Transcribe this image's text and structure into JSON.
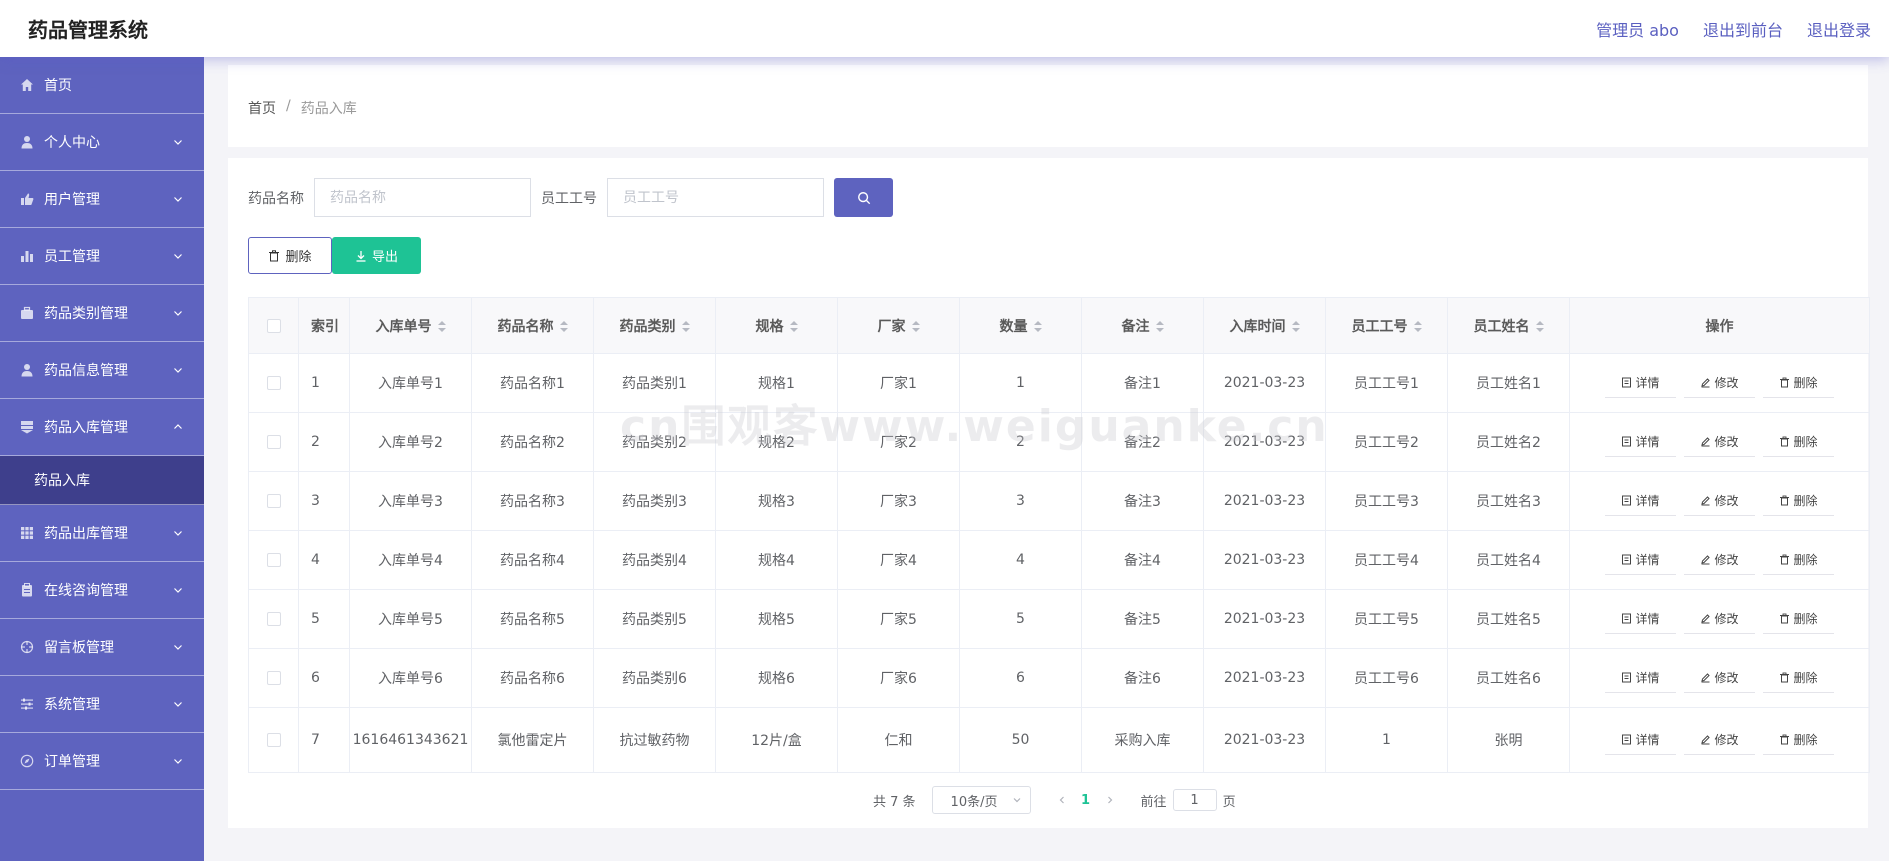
{
  "app": {
    "title": "药品管理系统"
  },
  "header": {
    "user": "管理员 abo",
    "front": "退出到前台",
    "logout": "退出登录"
  },
  "sidebar": {
    "items": [
      {
        "label": "首页",
        "icon": "home-icon",
        "expandable": false
      },
      {
        "label": "个人中心",
        "icon": "user-icon",
        "expandable": true
      },
      {
        "label": "用户管理",
        "icon": "thumb-icon",
        "expandable": true
      },
      {
        "label": "员工管理",
        "icon": "bar-chart-icon",
        "expandable": true
      },
      {
        "label": "药品类别管理",
        "icon": "briefcase-icon",
        "expandable": true
      },
      {
        "label": "药品信息管理",
        "icon": "user-icon",
        "expandable": true
      },
      {
        "label": "药品入库管理",
        "icon": "flag-icon",
        "expandable": true,
        "open": true
      },
      {
        "label": "药品出库管理",
        "icon": "grid-icon",
        "expandable": true
      },
      {
        "label": "在线咨询管理",
        "icon": "clipboard-icon",
        "expandable": true
      },
      {
        "label": "留言板管理",
        "icon": "aperture-icon",
        "expandable": true
      },
      {
        "label": "系统管理",
        "icon": "sliders-icon",
        "expandable": true
      },
      {
        "label": "订单管理",
        "icon": "compass-icon",
        "expandable": true
      }
    ],
    "subitem": "药品入库"
  },
  "breadcrumb": {
    "home": "首页",
    "separator": "/",
    "current": "药品入库"
  },
  "search": {
    "name_label": "药品名称",
    "name_placeholder": "药品名称",
    "staff_label": "员工工号",
    "staff_placeholder": "员工工号"
  },
  "actions": {
    "delete": "删除",
    "export": "导出"
  },
  "table": {
    "headers": [
      "索引",
      "入库单号",
      "药品名称",
      "药品类别",
      "规格",
      "厂家",
      "数量",
      "备注",
      "入库时间",
      "员工工号",
      "员工姓名",
      "操作"
    ],
    "rows": [
      [
        "1",
        "入库单号1",
        "药品名称1",
        "药品类别1",
        "规格1",
        "厂家1",
        "1",
        "备注1",
        "2021-03-23",
        "员工工号1",
        "员工姓名1"
      ],
      [
        "2",
        "入库单号2",
        "药品名称2",
        "药品类别2",
        "规格2",
        "厂家2",
        "2",
        "备注2",
        "2021-03-23",
        "员工工号2",
        "员工姓名2"
      ],
      [
        "3",
        "入库单号3",
        "药品名称3",
        "药品类别3",
        "规格3",
        "厂家3",
        "3",
        "备注3",
        "2021-03-23",
        "员工工号3",
        "员工姓名3"
      ],
      [
        "4",
        "入库单号4",
        "药品名称4",
        "药品类别4",
        "规格4",
        "厂家4",
        "4",
        "备注4",
        "2021-03-23",
        "员工工号4",
        "员工姓名4"
      ],
      [
        "5",
        "入库单号5",
        "药品名称5",
        "药品类别5",
        "规格5",
        "厂家5",
        "5",
        "备注5",
        "2021-03-23",
        "员工工号5",
        "员工姓名5"
      ],
      [
        "6",
        "入库单号6",
        "药品名称6",
        "药品类别6",
        "规格6",
        "厂家6",
        "6",
        "备注6",
        "2021-03-23",
        "员工工号6",
        "员工姓名6"
      ],
      [
        "7",
        "1616461343621",
        "氯他雷定片",
        "抗过敏药物",
        "12片/盒",
        "仁和",
        "50",
        "采购入库",
        "2021-03-23",
        "1",
        "张明"
      ]
    ],
    "op_labels": {
      "detail": "详情",
      "edit": "修改",
      "delete": "删除"
    }
  },
  "pagination": {
    "total": "共 7 条",
    "page_size": "10条/页",
    "current": "1",
    "goto_label": "前往",
    "goto_value": "1",
    "page_suffix": "页"
  },
  "watermark": "cn围观客www.weiguanke.cn",
  "colors": {
    "sidebar": "#5e63bf",
    "sidebar_active": "#3e3f8c",
    "accent": "#5e63bf",
    "export": "#1ec395"
  }
}
